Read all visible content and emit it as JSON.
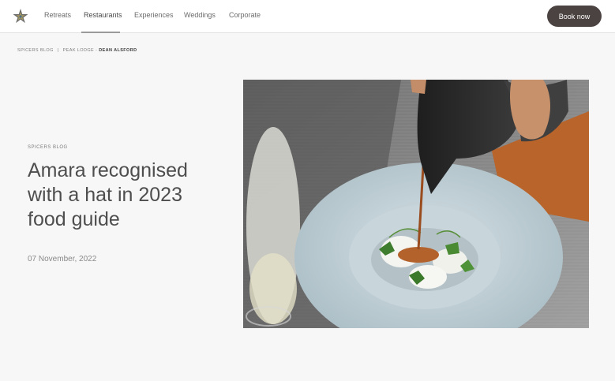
{
  "nav": {
    "logo": "spicers-star-logo",
    "items": [
      {
        "label": "Retreats"
      },
      {
        "label": "Restaurants",
        "active": true
      },
      {
        "label": "Experiences"
      },
      {
        "label": "Weddings"
      },
      {
        "label": "Corporate"
      }
    ],
    "book_label": "Book now"
  },
  "breadcrumb": {
    "items": [
      "SPICERS BLOG",
      "PEAK LODGE"
    ],
    "separator_1": "|",
    "separator_2": "-",
    "current": "DEAN ALSFORD"
  },
  "article": {
    "category": "SPICERS BLOG",
    "title_lines": [
      "Amara recognised",
      "with a hat in 2023",
      "food guide"
    ],
    "date": "07 November, 2022",
    "hero_image": "plated-dish-with-sauce-being-poured"
  },
  "colors": {
    "button_bg": "#4b4341",
    "page_bg": "#f7f7f7",
    "text": "#4a4a4a"
  }
}
